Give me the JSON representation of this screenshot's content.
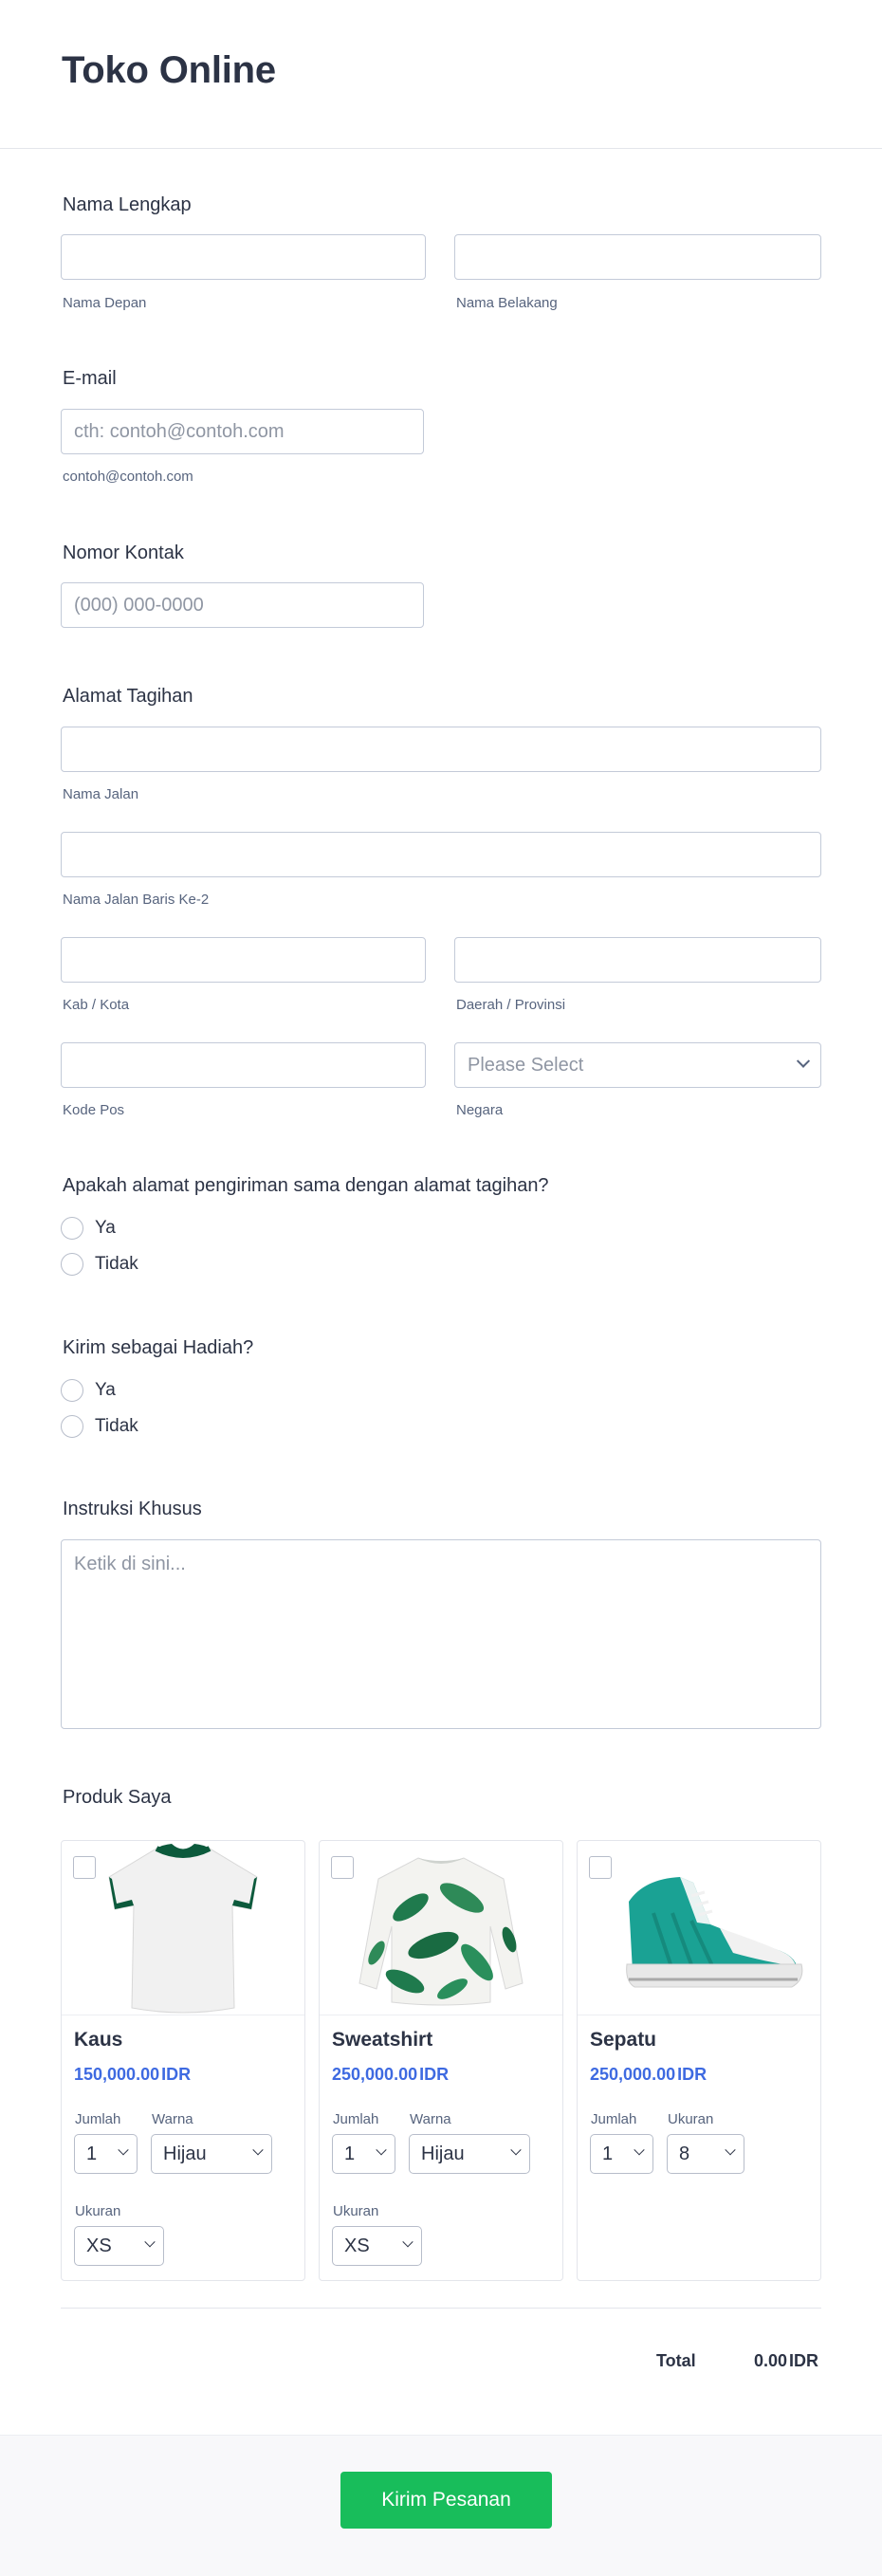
{
  "header": {
    "title": "Toko Online"
  },
  "full_name": {
    "label": "Nama Lengkap",
    "first_value": "",
    "last_value": "",
    "first_sublabel": "Nama Depan",
    "last_sublabel": "Nama Belakang"
  },
  "email": {
    "label": "E-mail",
    "placeholder": "cth: contoh@contoh.com",
    "sublabel": "contoh@contoh.com"
  },
  "phone": {
    "label": "Nomor Kontak",
    "placeholder": "(000) 000-0000"
  },
  "billing": {
    "label": "Alamat Tagihan",
    "street_sublabel": "Nama Jalan",
    "street2_sublabel": "Nama Jalan Baris Ke-2",
    "city_sublabel": "Kab / Kota",
    "state_sublabel": "Daerah / Provinsi",
    "zip_sublabel": "Kode Pos",
    "country_sublabel": "Negara",
    "country_placeholder": "Please Select"
  },
  "same_address": {
    "question": "Apakah alamat pengiriman sama dengan alamat tagihan?",
    "options": [
      "Ya",
      "Tidak"
    ]
  },
  "gift": {
    "question": "Kirim sebagai Hadiah?",
    "options": [
      "Ya",
      "Tidak"
    ]
  },
  "instructions": {
    "label": "Instruksi Khusus",
    "placeholder": "Ketik di sini..."
  },
  "products": {
    "label": "Produk Saya",
    "items": [
      {
        "name": "Kaus",
        "price": "150,000.00",
        "currency": "IDR",
        "qty_label": "Jumlah",
        "qty": "1",
        "color_label": "Warna",
        "color": "Hijau",
        "size_label": "Ukuran",
        "size": "XS"
      },
      {
        "name": "Sweatshirt",
        "price": "250,000.00",
        "currency": "IDR",
        "qty_label": "Jumlah",
        "qty": "1",
        "color_label": "Warna",
        "color": "Hijau",
        "size_label": "Ukuran",
        "size": "XS"
      },
      {
        "name": "Sepatu",
        "price": "250,000.00",
        "currency": "IDR",
        "qty_label": "Jumlah",
        "qty": "1",
        "size_label": "Ukuran",
        "size": "8"
      }
    ]
  },
  "total": {
    "label": "Total",
    "value": "0.00",
    "currency": "IDR"
  },
  "submit": {
    "label": "Kirim Pesanan"
  },
  "colors": {
    "accent": "#18bd5b",
    "price": "#3e6ae1",
    "text": "#2c3345",
    "border": "#c3cad8"
  }
}
